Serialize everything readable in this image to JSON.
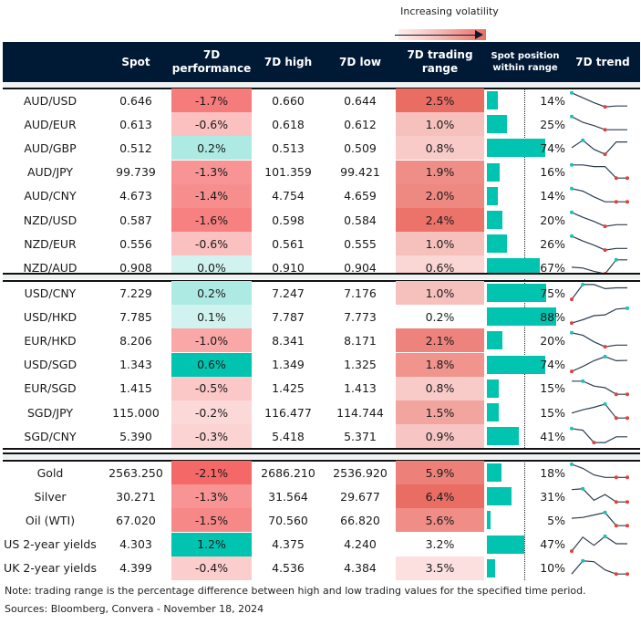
{
  "legend": {
    "label": "Increasing volatility",
    "colors": [
      "#fdeeee",
      "#fad4d2",
      "#f5b5b1",
      "#f0908a",
      "#ea6d64"
    ]
  },
  "header": {
    "spot": "Spot",
    "perf_line1": "7D",
    "perf_line2": "performance",
    "high": "7D high",
    "low": "7D low",
    "range_line1": "7D trading",
    "range_line2": "range",
    "position_line1": "Spot position",
    "position_line2": "within range",
    "trend": "7D trend"
  },
  "colors": {
    "header_bg": "#001a36",
    "positive": "#00c4b0",
    "negative": "#f56b6b",
    "bar": "#00c4b0",
    "spark_line": "#2c3e50",
    "spark_high": "#17c3b2",
    "spark_low": "#e0413a"
  },
  "groups": [
    {
      "rows": [
        {
          "label": "AUD/USD",
          "spot": "0.646",
          "perf": "-1.7%",
          "perf_val": -1.7,
          "high": "0.660",
          "low": "0.644",
          "range": "2.5%",
          "range_val": 2.5,
          "position": "14%",
          "position_val": 14,
          "trend": [
            0.9,
            0.6,
            0.3,
            0.05,
            0.1,
            0.1
          ],
          "hi_idx": 0,
          "lo_idx": [
            3
          ]
        },
        {
          "label": "AUD/EUR",
          "spot": "0.613",
          "perf": "-0.6%",
          "perf_val": -0.6,
          "high": "0.618",
          "low": "0.612",
          "range": "1.0%",
          "range_val": 1.0,
          "position": "25%",
          "position_val": 25,
          "trend": [
            0.9,
            0.55,
            0.35,
            0.1,
            0.1,
            0.1
          ],
          "hi_idx": 0,
          "lo_idx": [
            3
          ]
        },
        {
          "label": "AUD/GBP",
          "spot": "0.512",
          "perf": "0.2%",
          "perf_val": 0.2,
          "high": "0.513",
          "low": "0.509",
          "range": "0.8%",
          "range_val": 0.8,
          "position": "74%",
          "position_val": 74,
          "trend": [
            0.45,
            0.9,
            0.35,
            0.05,
            0.8,
            0.8
          ],
          "hi_idx": 1,
          "lo_idx": [
            3
          ]
        },
        {
          "label": "AUD/JPY",
          "spot": "99.739",
          "perf": "-1.3%",
          "perf_val": -1.3,
          "high": "101.359",
          "low": "99.421",
          "range": "1.9%",
          "range_val": 1.9,
          "position": "16%",
          "position_val": 16,
          "trend": [
            0.9,
            0.9,
            0.8,
            0.8,
            0.1,
            0.1
          ],
          "hi_idx": 0,
          "lo_idx": [
            4,
            5
          ]
        },
        {
          "label": "AUD/CNY",
          "spot": "4.673",
          "perf": "-1.4%",
          "perf_val": -1.4,
          "high": "4.754",
          "low": "4.659",
          "range": "2.0%",
          "range_val": 2.0,
          "position": "14%",
          "position_val": 14,
          "trend": [
            0.9,
            0.75,
            0.4,
            0.1,
            0.1,
            0.1
          ],
          "hi_idx": 0,
          "lo_idx": [
            4,
            5
          ]
        },
        {
          "label": "NZD/USD",
          "spot": "0.587",
          "perf": "-1.6%",
          "perf_val": -1.6,
          "high": "0.598",
          "low": "0.584",
          "range": "2.4%",
          "range_val": 2.4,
          "position": "20%",
          "position_val": 20,
          "trend": [
            0.9,
            0.6,
            0.35,
            0.05,
            0.15,
            0.15
          ],
          "hi_idx": 0,
          "lo_idx": [
            3
          ]
        },
        {
          "label": "NZD/EUR",
          "spot": "0.556",
          "perf": "-0.6%",
          "perf_val": -0.6,
          "high": "0.561",
          "low": "0.555",
          "range": "1.0%",
          "range_val": 1.0,
          "position": "26%",
          "position_val": 26,
          "trend": [
            0.9,
            0.6,
            0.35,
            0.05,
            0.15,
            0.15
          ],
          "hi_idx": 0,
          "lo_idx": [
            3
          ]
        },
        {
          "label": "NZD/AUD",
          "spot": "0.908",
          "perf": "0.0%",
          "perf_val": 0.0,
          "high": "0.910",
          "low": "0.904",
          "range": "0.6%",
          "range_val": 0.6,
          "position": "67%",
          "position_val": 67,
          "trend": [
            0.45,
            0.4,
            0.2,
            0.05,
            0.9,
            0.9
          ],
          "hi_idx": 4,
          "lo_idx": [
            3
          ]
        }
      ]
    },
    {
      "rows": [
        {
          "label": "USD/CNY",
          "spot": "7.229",
          "perf": "0.2%",
          "perf_val": 0.2,
          "high": "7.247",
          "low": "7.176",
          "range": "1.0%",
          "range_val": 1.0,
          "position": "75%",
          "position_val": 75,
          "trend": [
            0.05,
            0.95,
            0.95,
            0.7,
            0.75,
            0.75
          ],
          "hi_idx": 1,
          "lo_idx": [
            0
          ]
        },
        {
          "label": "USD/HKD",
          "spot": "7.785",
          "perf": "0.1%",
          "perf_val": 0.1,
          "high": "7.787",
          "low": "7.773",
          "range": "0.2%",
          "range_val": 0.2,
          "position": "88%",
          "position_val": 88,
          "trend": [
            0.05,
            0.25,
            0.5,
            0.55,
            0.9,
            0.95
          ],
          "hi_idx": 5,
          "lo_idx": [
            0
          ]
        },
        {
          "label": "EUR/HKD",
          "spot": "8.206",
          "perf": "-1.0%",
          "perf_val": -1.0,
          "high": "8.341",
          "low": "8.171",
          "range": "2.1%",
          "range_val": 2.1,
          "position": "20%",
          "position_val": 20,
          "trend": [
            0.9,
            0.75,
            0.35,
            0.05,
            0.15,
            0.15
          ],
          "hi_idx": 0,
          "lo_idx": [
            3
          ]
        },
        {
          "label": "USD/SGD",
          "spot": "1.343",
          "perf": "0.6%",
          "perf_val": 0.6,
          "high": "1.349",
          "low": "1.325",
          "range": "1.8%",
          "range_val": 1.8,
          "position": "74%",
          "position_val": 74,
          "trend": [
            0.05,
            0.35,
            0.7,
            0.95,
            0.7,
            0.72
          ],
          "hi_idx": 3,
          "lo_idx": [
            0
          ]
        },
        {
          "label": "EUR/SGD",
          "spot": "1.415",
          "perf": "-0.5%",
          "perf_val": -0.5,
          "high": "1.425",
          "low": "1.413",
          "range": "0.8%",
          "range_val": 0.8,
          "position": "15%",
          "position_val": 15,
          "trend": [
            0.9,
            0.9,
            0.6,
            0.5,
            0.1,
            0.1
          ],
          "hi_idx": 1,
          "lo_idx": [
            4,
            5
          ]
        },
        {
          "label": "SGD/JPY",
          "spot": "115.000",
          "perf": "-0.2%",
          "perf_val": -0.2,
          "high": "116.477",
          "low": "114.744",
          "range": "1.5%",
          "range_val": 1.5,
          "position": "15%",
          "position_val": 15,
          "trend": [
            0.4,
            0.6,
            0.75,
            0.95,
            0.1,
            0.1
          ],
          "hi_idx": 3,
          "lo_idx": [
            4,
            5
          ]
        },
        {
          "label": "SGD/CNY",
          "spot": "5.390",
          "perf": "-0.3%",
          "perf_val": -0.3,
          "high": "5.418",
          "low": "5.371",
          "range": "0.9%",
          "range_val": 0.9,
          "position": "41%",
          "position_val": 41,
          "trend": [
            0.9,
            0.8,
            0.05,
            0.05,
            0.4,
            0.4
          ],
          "hi_idx": 0,
          "lo_idx": [
            2
          ]
        }
      ]
    },
    {
      "rows": [
        {
          "label": "Gold",
          "spot": "2563.250",
          "perf": "-2.1%",
          "perf_val": -2.1,
          "high": "2686.210",
          "low": "2536.920",
          "range": "5.9%",
          "range_val": 5.9,
          "position": "18%",
          "position_val": 18,
          "trend": [
            0.95,
            0.7,
            0.3,
            0.15,
            0.15,
            0.15
          ],
          "hi_idx": 0,
          "lo_idx": [
            4,
            5
          ]
        },
        {
          "label": "Silver",
          "spot": "30.271",
          "perf": "-1.3%",
          "perf_val": -1.3,
          "high": "31.564",
          "low": "29.677",
          "range": "6.4%",
          "range_val": 6.4,
          "position": "31%",
          "position_val": 31,
          "trend": [
            0.85,
            0.9,
            0.2,
            0.55,
            0.1,
            0.1
          ],
          "hi_idx": 1,
          "lo_idx": [
            4,
            5
          ]
        },
        {
          "label": "Oil (WTI)",
          "spot": "67.020",
          "perf": "-1.5%",
          "perf_val": -1.5,
          "high": "70.560",
          "low": "66.820",
          "range": "5.6%",
          "range_val": 5.6,
          "position": "5%",
          "position_val": 5,
          "trend": [
            0.55,
            0.6,
            0.75,
            0.9,
            0.1,
            0.1
          ],
          "hi_idx": 3,
          "lo_idx": [
            4,
            5
          ]
        },
        {
          "label": "US 2-year yields",
          "spot": "4.303",
          "perf": "1.2%",
          "perf_val": 1.2,
          "high": "4.375",
          "low": "4.240",
          "range": "3.2%",
          "range_val": 3.2,
          "position": "47%",
          "position_val": 47,
          "trend": [
            0.05,
            0.9,
            0.4,
            0.95,
            0.5,
            0.5
          ],
          "hi_idx": 3,
          "lo_idx": [
            0
          ]
        },
        {
          "label": "UK 2-year yields",
          "spot": "4.399",
          "perf": "-0.4%",
          "perf_val": -0.4,
          "high": "4.536",
          "low": "4.384",
          "range": "3.5%",
          "range_val": 3.5,
          "position": "10%",
          "position_val": 10,
          "trend": [
            0.1,
            0.9,
            0.85,
            0.35,
            0.1,
            0.1
          ],
          "hi_idx": 1,
          "lo_idx": [
            4,
            5
          ]
        }
      ]
    }
  ],
  "footer": {
    "note": "Note: trading range is the percentage difference between high and low trading values for the specified time period.",
    "sources": "Sources: Bloomberg, Convera - November 18, 2024"
  }
}
